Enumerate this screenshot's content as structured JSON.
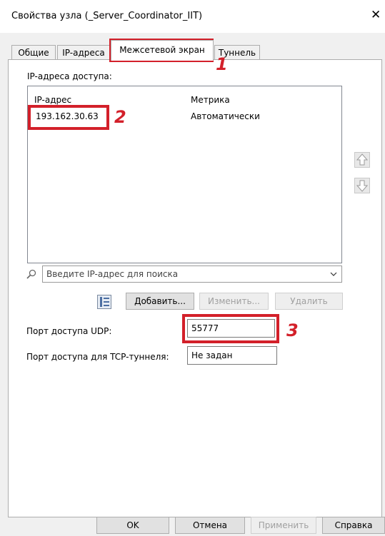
{
  "window": {
    "title": "Свойства узла (_Server_Coordinator_IIT)",
    "close_glyph": "✕"
  },
  "tabs": [
    {
      "label": "Общие"
    },
    {
      "label": "IP-адреса"
    },
    {
      "label": "Межсетевой экран"
    },
    {
      "label": "Туннель"
    }
  ],
  "ip_section": {
    "label": "IP-адреса доступа:",
    "columns": [
      "IP-адрес",
      "Метрика"
    ],
    "rows": [
      {
        "ip": "193.162.30.63",
        "metric": "Автоматически"
      }
    ]
  },
  "search": {
    "placeholder": "Введите IP-адрес для поиска"
  },
  "actions": {
    "add": "Добавить...",
    "edit": "Изменить...",
    "delete": "Удалить"
  },
  "udp": {
    "label": "Порт доступа UDP:",
    "value": "55777"
  },
  "tcp": {
    "label": "Порт доступа для TCP-туннеля:",
    "value": "Не задан"
  },
  "footer": {
    "ok": "OK",
    "cancel": "Отмена",
    "apply": "Применить",
    "help": "Справка"
  },
  "callouts": [
    "1",
    "2",
    "3"
  ],
  "colors": {
    "highlight": "#d3202a",
    "border": "#adadad"
  }
}
